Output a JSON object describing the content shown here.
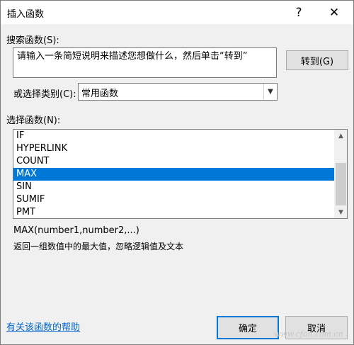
{
  "window": {
    "title": "插入函数",
    "help_label": "?",
    "close_label": "✕"
  },
  "search": {
    "label": "搜索函数(S):",
    "text": "请输入一条简短说明来描述您想做什么，然后单击“转到”",
    "go_label": "转到(G)"
  },
  "category": {
    "label": "或选择类别(C):",
    "selected": "常用函数"
  },
  "functions": {
    "label": "选择函数(N):",
    "items": [
      {
        "name": "IF",
        "selected": false
      },
      {
        "name": "HYPERLINK",
        "selected": false
      },
      {
        "name": "COUNT",
        "selected": false
      },
      {
        "name": "MAX",
        "selected": true
      },
      {
        "name": "SIN",
        "selected": false
      },
      {
        "name": "SUMIF",
        "selected": false
      },
      {
        "name": "PMT",
        "selected": false
      }
    ]
  },
  "selected_function": {
    "signature": "MAX(number1,number2,...)",
    "description": "返回一组数值中的最大值，忽略逻辑值及文本"
  },
  "footer": {
    "help_link": "有关该函数的帮助",
    "ok_label": "确定",
    "cancel_label": "取消",
    "watermark": "www.cfan.com.cn"
  },
  "colors": {
    "selection": "#0078d7",
    "link": "#0066cc"
  }
}
